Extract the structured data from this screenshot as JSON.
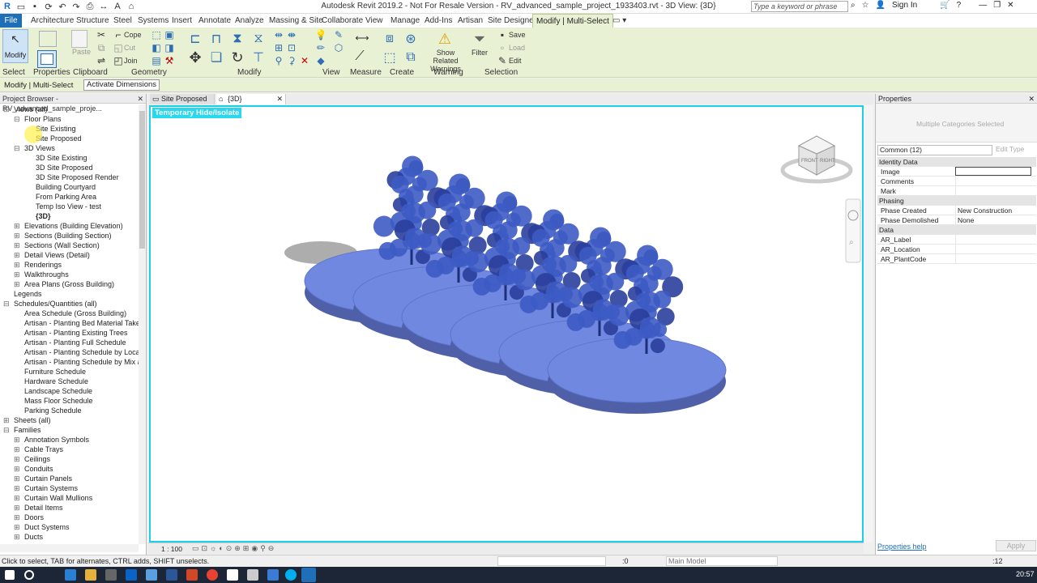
{
  "app": {
    "title": "Autodesk Revit 2019.2 - Not For Resale Version - RV_advanced_sample_project_1933403.rvt - 3D View: {3D}",
    "search_placeholder": "Type a keyword or phrase",
    "sign_in": "Sign In"
  },
  "ribbon_tabs": [
    "File",
    "Architecture",
    "Structure",
    "Steel",
    "Systems",
    "Insert",
    "Annotate",
    "Analyze",
    "Massing & Site",
    "Collaborate",
    "View",
    "Manage",
    "Add-Ins",
    "Artisan",
    "Site Designer",
    "Modify | Multi-Select"
  ],
  "ribbon": {
    "modify": "Modify",
    "paste": "Paste",
    "cope": "Cope",
    "cut": "Cut",
    "join": "Join",
    "show_related_warnings": "Show Related Warnings",
    "filter": "Filter",
    "save": "Save",
    "load": "Load",
    "edit": "Edit",
    "panels": [
      "Select",
      "Properties",
      "Clipboard",
      "Geometry",
      "Modify",
      "View",
      "Measure",
      "Create",
      "Warning",
      "Selection"
    ]
  },
  "options_bar": {
    "context": "Modify | Multi-Select",
    "activate_dimensions": "Activate Dimensions"
  },
  "project_browser": {
    "title": "Project Browser - RV_advanced_sample_proje...",
    "items": [
      "Views (all)",
      "Floor Plans",
      "Site Existing",
      "Site Proposed",
      "3D Views",
      "3D Site Existing",
      "3D Site Proposed",
      "3D Site Proposed Render",
      "Building Courtyard",
      "From Parking Area",
      "Temp Iso View - test",
      "{3D}",
      "Elevations (Building Elevation)",
      "Sections (Building Section)",
      "Sections (Wall Section)",
      "Detail Views (Detail)",
      "Renderings",
      "Walkthroughs",
      "Area Plans (Gross Building)",
      "Legends",
      "Schedules/Quantities (all)",
      "Area Schedule (Gross Building)",
      "Artisan - Planting Bed Material Takeoff",
      "Artisan - Planting Existing Trees",
      "Artisan - Planting Full Schedule",
      "Artisan - Planting Schedule by Location",
      "Artisan - Planting Schedule by Mix and",
      "Furniture Schedule",
      "Hardware Schedule",
      "Landscape Schedule",
      "Mass Floor Schedule",
      "Parking Schedule",
      "Sheets (all)",
      "Families",
      "Annotation Symbols",
      "Cable Trays",
      "Ceilings",
      "Conduits",
      "Curtain Panels",
      "Curtain Systems",
      "Curtain Wall Mullions",
      "Detail Items",
      "Doors",
      "Duct Systems",
      "Ducts"
    ]
  },
  "view_tabs": [
    "Site Proposed",
    "{3D}"
  ],
  "viewport": {
    "temporary_label": "Temporary Hide/Isolate",
    "scale": "1 : 100",
    "viewcube_front": "FRONT",
    "viewcube_right": "RIGHT"
  },
  "properties": {
    "title": "Properties",
    "type_selector": "Multiple Categories Selected",
    "filter": "Common (12)",
    "edit_type": "Edit Type",
    "groups": [
      {
        "name": "Identity Data",
        "rows": [
          {
            "k": "Image",
            "v": ""
          },
          {
            "k": "Comments",
            "v": ""
          },
          {
            "k": "Mark",
            "v": ""
          }
        ]
      },
      {
        "name": "Phasing",
        "rows": [
          {
            "k": "Phase Created",
            "v": "New Construction"
          },
          {
            "k": "Phase Demolished",
            "v": "None"
          }
        ]
      },
      {
        "name": "Data",
        "rows": [
          {
            "k": "AR_Label",
            "v": ""
          },
          {
            "k": "AR_Location",
            "v": ""
          },
          {
            "k": "AR_PlantCode",
            "v": ""
          }
        ]
      }
    ],
    "help": "Properties help",
    "apply": "Apply"
  },
  "status": {
    "hint": "Click to select, TAB for alternates, CTRL adds, SHIFT unselects.",
    "zero": ":0",
    "model": "Main Model",
    "filter_count": ":12"
  },
  "taskbar": {
    "time": "20:57"
  },
  "colors": {
    "ribbon_bg": "#e8f1d4",
    "accent": "#1e6fb8",
    "isolate": "#29d7ef",
    "tree_blue": "#3d5bc4"
  }
}
